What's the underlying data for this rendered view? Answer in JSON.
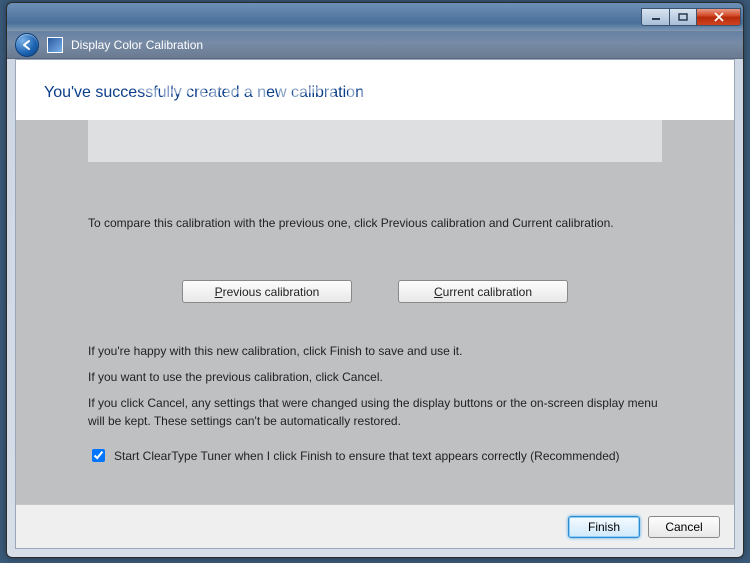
{
  "watermark": "SevenForums.com",
  "window": {
    "app_title": "Display Color Calibration"
  },
  "page": {
    "heading": "You've successfully created a new calibration",
    "instruction_compare": "To compare this calibration with the previous one, click Previous calibration and Current calibration.",
    "btn_previous_prefix": "P",
    "btn_previous_rest": "revious calibration",
    "btn_current_prefix": "C",
    "btn_current_rest": "urrent calibration",
    "happy_text": "If you're happy with this new calibration, click Finish to save and use it.",
    "previous_text": "If you want to use the previous calibration, click Cancel.",
    "cancel_note": "If you click Cancel, any settings that were changed using the display buttons or the on-screen display menu will be kept. These settings can't be automatically restored.",
    "cleartype_label": "Start ClearType Tuner when I click Finish to ensure that text appears correctly (Recommended)"
  },
  "footer": {
    "finish": "Finish",
    "cancel": "Cancel"
  }
}
